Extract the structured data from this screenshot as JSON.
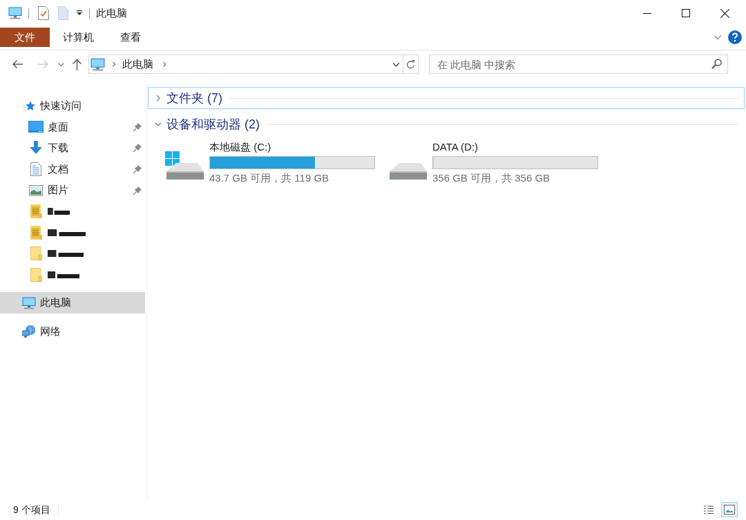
{
  "window": {
    "title": "此电脑"
  },
  "ribbon": {
    "tabs": [
      {
        "label": "文件",
        "kind": "file"
      },
      {
        "label": "计算机",
        "kind": "tab"
      },
      {
        "label": "查看",
        "kind": "tab"
      }
    ]
  },
  "address_bar": {
    "path": [
      "此电脑"
    ]
  },
  "search": {
    "placeholder": "在 此电脑 中搜索"
  },
  "navigation_pane": {
    "items": [
      {
        "label": "快速访问",
        "kind": "quick_access",
        "selected": false,
        "children": [
          {
            "label": "桌面",
            "kind": "desktop",
            "pinned": true,
            "selected": false
          },
          {
            "label": "下载",
            "kind": "downloads",
            "pinned": true,
            "selected": false
          },
          {
            "label": "文档",
            "kind": "documents",
            "pinned": true,
            "selected": false
          },
          {
            "label": "图片",
            "kind": "pictures",
            "pinned": true,
            "selected": false
          },
          {
            "kind": "folder_content",
            "redacted": true,
            "pinned": false,
            "selected": false
          },
          {
            "kind": "folder_content",
            "redacted": true,
            "pinned": false,
            "selected": false
          },
          {
            "kind": "folder",
            "redacted": true,
            "pinned": false,
            "selected": false
          },
          {
            "kind": "folder",
            "redacted": true,
            "pinned": false,
            "selected": false
          }
        ]
      },
      {
        "label": "此电脑",
        "kind": "this_pc",
        "selected": true
      },
      {
        "label": "网络",
        "kind": "network",
        "selected": false
      }
    ]
  },
  "groups": [
    {
      "title": "文件夹 (7)",
      "expanded": false,
      "focused": true
    },
    {
      "title": "设备和驱动器 (2)",
      "expanded": true,
      "focused": false,
      "drives": [
        {
          "name": "本地磁盘 (C:)",
          "kind": "system",
          "level": 0.64,
          "reading": "43.7 GB 可用，共 119 GB"
        },
        {
          "name": "DATA (D:)",
          "kind": "data",
          "level": 0,
          "reading": "356 GB 可用，共 356 GB"
        }
      ]
    }
  ],
  "status_bar": {
    "item_count": "9 个项目",
    "views": [
      {
        "kind": "details",
        "selected": false
      },
      {
        "kind": "large_icons",
        "selected": true
      }
    ]
  }
}
